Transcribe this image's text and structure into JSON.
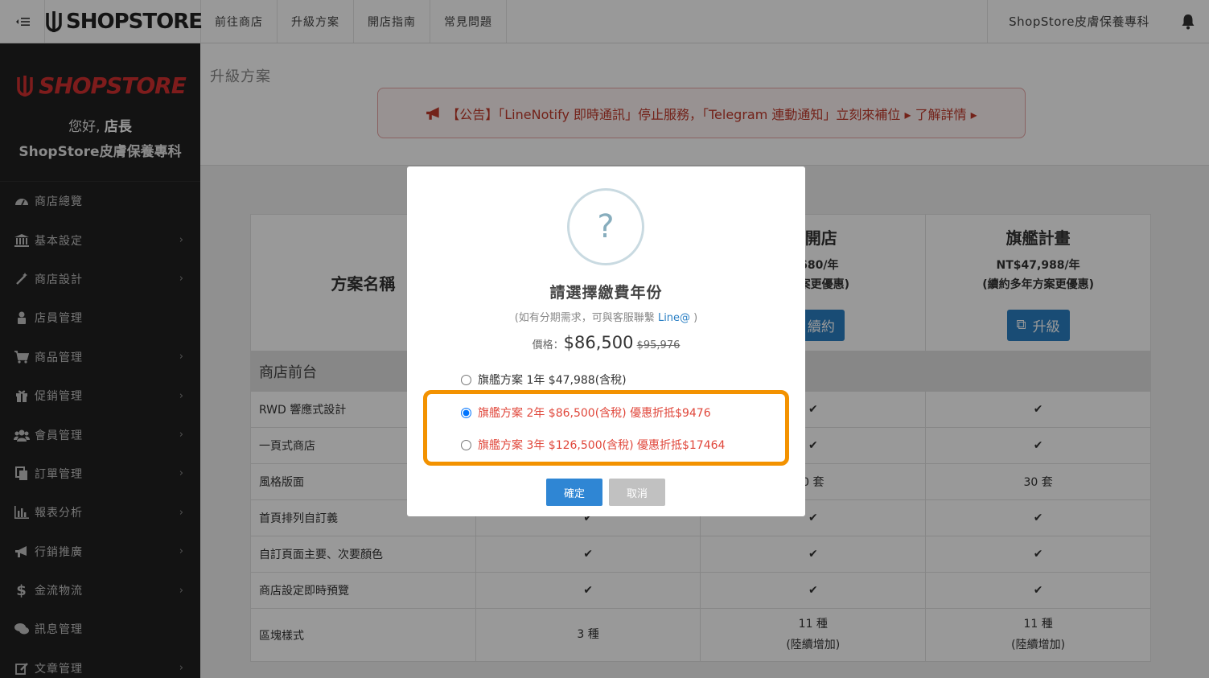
{
  "topbar": {
    "toggle_icon": "menu-toggle-icon",
    "logo": "SHOPSTORE",
    "nav": [
      "前往商店",
      "升級方案",
      "開店指南",
      "常見問題"
    ],
    "store_name": "ShopStore皮膚保養專科",
    "bell_icon": "bell-icon"
  },
  "sidebar": {
    "brand_logo": "SHOPSTORE",
    "greeting": "您好,",
    "role": "店長",
    "store_name": "ShopStore皮膚保養專科",
    "items": [
      {
        "label": "商店總覽",
        "icon": "dashboard-icon",
        "has_children": false
      },
      {
        "label": "基本設定",
        "icon": "bank-icon",
        "has_children": true
      },
      {
        "label": "商店設計",
        "icon": "magic-wand-icon",
        "has_children": true
      },
      {
        "label": "店員管理",
        "icon": "user-lock-icon",
        "has_children": false
      },
      {
        "label": "商品管理",
        "icon": "cart-icon",
        "has_children": true
      },
      {
        "label": "促銷管理",
        "icon": "gift-icon",
        "has_children": true
      },
      {
        "label": "會員管理",
        "icon": "users-icon",
        "has_children": true
      },
      {
        "label": "訂單管理",
        "icon": "copy-icon",
        "has_children": true
      },
      {
        "label": "報表分析",
        "icon": "bar-chart-icon",
        "has_children": true
      },
      {
        "label": "行銷推廣",
        "icon": "bullhorn-icon",
        "has_children": true
      },
      {
        "label": "金流物流",
        "icon": "dollar-icon",
        "has_children": true
      },
      {
        "label": "訊息管理",
        "icon": "comments-icon",
        "has_children": false
      },
      {
        "label": "文章管理",
        "icon": "edit-icon",
        "has_children": true
      }
    ]
  },
  "content": {
    "page_title": "升級方案",
    "notice": "【公告】「LineNotify 即時通訊」停止服務，「Telegram 連動通知」立刻來補位 ▸ 了解詳情 ▸"
  },
  "table": {
    "header_label": "方案名稱",
    "plans": [
      {
        "name": "",
        "price": "",
        "note": "",
        "button": ""
      },
      {
        "name": "寶開店",
        "price": "4,680/年",
        "note": "年方案更優惠)",
        "button": "續約"
      },
      {
        "name": "旗艦計畫",
        "price": "NT$47,988/年",
        "note": "(續約多年方案更優惠)",
        "button": "升級"
      }
    ],
    "section": "商店前台",
    "rows": [
      {
        "label": "RWD 響應式設計",
        "values": [
          "",
          "✔",
          "✔"
        ]
      },
      {
        "label": "一頁式商店",
        "values": [
          "",
          "✔",
          "✔"
        ]
      },
      {
        "label": "風格版面",
        "values": [
          "",
          "0 套",
          "30 套"
        ]
      },
      {
        "label": "首頁排列自訂義",
        "values": [
          "✔",
          "✔",
          "✔"
        ]
      },
      {
        "label": "自訂頁面主要、次要顏色",
        "values": [
          "✔",
          "✔",
          "✔"
        ]
      },
      {
        "label": "商店設定即時預覽",
        "values": [
          "✔",
          "✔",
          "✔"
        ]
      },
      {
        "label": "區塊樣式",
        "values": [
          "3 種",
          "11 種\n(陸續增加)",
          "11 種\n(陸續增加)"
        ]
      }
    ]
  },
  "modal": {
    "icon": "question-icon",
    "title": "請選擇繳費年份",
    "subtitle_prefix": "(如有分期需求，可與客服聯繫 ",
    "subtitle_link": "Line@",
    "subtitle_suffix": " )",
    "price_label": "價格：",
    "price": "$86,500",
    "price_old": "$95,976",
    "options": [
      {
        "label": "旗艦方案 1年 $47,988(含稅)",
        "checked": false,
        "highlight": false
      },
      {
        "label": "旗艦方案 2年 $86,500(含稅) 優惠折抵$9476",
        "checked": true,
        "highlight": true
      },
      {
        "label": "旗艦方案 3年 $126,500(含稅) 優惠折抵$17464",
        "checked": false,
        "highlight": true
      }
    ],
    "confirm": "確定",
    "cancel": "取消"
  }
}
